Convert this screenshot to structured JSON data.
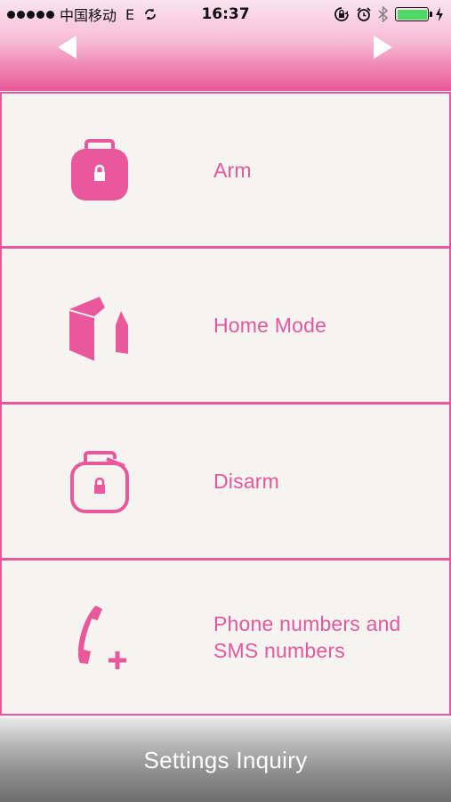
{
  "status_bar": {
    "carrier": "中国移动",
    "network": "E",
    "time": "16:37"
  },
  "menu": {
    "items": [
      {
        "label": "Arm",
        "icon": "locked-padlock-icon"
      },
      {
        "label": "Home Mode",
        "icon": "house-icon"
      },
      {
        "label": "Disarm",
        "icon": "unlocked-padlock-icon"
      },
      {
        "label": "Phone numbers and SMS numbers",
        "icon": "phone-add-icon"
      }
    ]
  },
  "footer": {
    "label": "Settings Inquiry"
  },
  "colors": {
    "accent": "#e8589a",
    "item_background": "#f5f4f1",
    "footer_text": "#ffffff"
  }
}
